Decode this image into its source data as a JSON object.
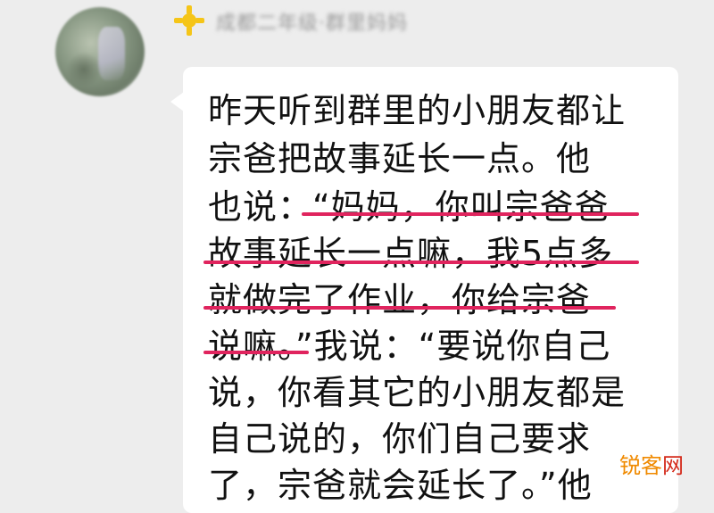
{
  "sender": {
    "name": "成都二年级·群里妈妈"
  },
  "message": {
    "lines": [
      "昨天听到群里的小朋友都让",
      "宗爸把故事延长一点。他",
      "也说：“妈妈，你叫宗爸爸",
      "故事延长一点嘛，我5点多",
      "就做完了作业，你给宗爸",
      "说嘛。”我说：“要说你自己",
      "说，你看其它的小朋友都是",
      "自己说的，你们自己要求",
      "了，宗爸就会延长了。”他"
    ],
    "highlight_color": "#e0245e"
  },
  "watermark": {
    "part1": "锐客",
    "part2": "网"
  },
  "colors": {
    "background": "#ededed",
    "bubble": "#ffffff",
    "badge": "#f5c518"
  }
}
